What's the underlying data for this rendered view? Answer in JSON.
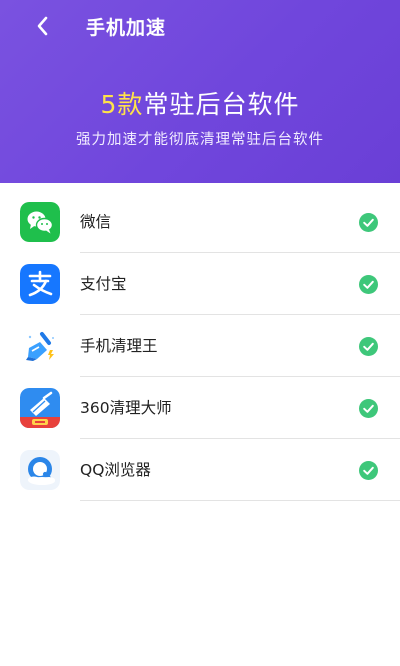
{
  "header": {
    "title": "手机加速",
    "headline_count": "5款",
    "headline_rest": "常驻后台软件",
    "subtitle": "强力加速才能彻底清理常驻后台软件"
  },
  "colors": {
    "header_gradient_start": "#7a52e0",
    "header_gradient_end": "#6a3fd6",
    "highlight": "#ffe24a",
    "check": "#3ec77a"
  },
  "apps": [
    {
      "name": "微信",
      "icon": "wechat-icon",
      "selected": true
    },
    {
      "name": "支付宝",
      "icon": "alipay-icon",
      "selected": true
    },
    {
      "name": "手机清理王",
      "icon": "phone-cleaner-icon",
      "selected": true
    },
    {
      "name": "360清理大师",
      "icon": "360-cleaner-icon",
      "selected": true
    },
    {
      "name": "QQ浏览器",
      "icon": "qq-browser-icon",
      "selected": true
    }
  ]
}
